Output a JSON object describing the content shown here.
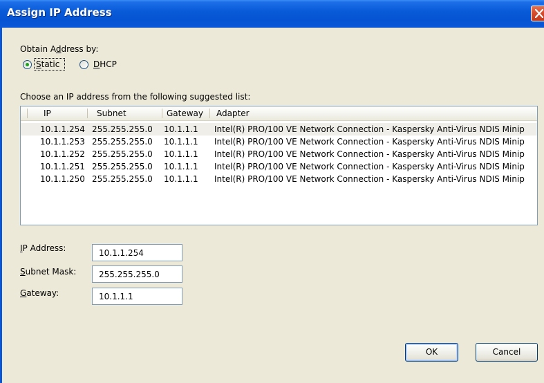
{
  "window": {
    "title": "Assign IP Address"
  },
  "obtain": {
    "label_pre": "Obtain A",
    "label_accel": "d",
    "label_post": "dress by:",
    "options": [
      {
        "accel": "S",
        "rest": "tatic",
        "selected": true
      },
      {
        "accel": "D",
        "rest": "HCP",
        "selected": false
      }
    ]
  },
  "suggested": {
    "label": "Choose an IP address from the following suggested list:",
    "columns": [
      "IP",
      "Subnet",
      "Gateway",
      "Adapter"
    ],
    "rows": [
      {
        "ip": "10.1.1.254",
        "subnet": "255.255.255.0",
        "gateway": "10.1.1.1",
        "adapter": "Intel(R) PRO/100 VE Network Connection - Kaspersky Anti-Virus NDIS Minip",
        "selected": true
      },
      {
        "ip": "10.1.1.253",
        "subnet": "255.255.255.0",
        "gateway": "10.1.1.1",
        "adapter": "Intel(R) PRO/100 VE Network Connection - Kaspersky Anti-Virus NDIS Minip",
        "selected": false
      },
      {
        "ip": "10.1.1.252",
        "subnet": "255.255.255.0",
        "gateway": "10.1.1.1",
        "adapter": "Intel(R) PRO/100 VE Network Connection - Kaspersky Anti-Virus NDIS Minip",
        "selected": false
      },
      {
        "ip": "10.1.1.251",
        "subnet": "255.255.255.0",
        "gateway": "10.1.1.1",
        "adapter": "Intel(R) PRO/100 VE Network Connection - Kaspersky Anti-Virus NDIS Minip",
        "selected": false
      },
      {
        "ip": "10.1.1.250",
        "subnet": "255.255.255.0",
        "gateway": "10.1.1.1",
        "adapter": "Intel(R) PRO/100 VE Network Connection - Kaspersky Anti-Virus NDIS Minip",
        "selected": false
      }
    ]
  },
  "fields": {
    "ip_address": {
      "accel": "I",
      "rest": "P Address:",
      "value": "10.1.1.254"
    },
    "subnet_mask": {
      "accel": "S",
      "rest": "ubnet Mask:",
      "value": "255.255.255.0"
    },
    "gateway": {
      "accel": "G",
      "rest": "ateway:",
      "value": "10.1.1.1"
    }
  },
  "buttons": {
    "ok": "OK",
    "cancel": "Cancel"
  },
  "colors": {
    "titlebar": "#0554d3",
    "dialog_bg": "#ece9d8",
    "radio_dot": "#21a121",
    "close_button": "#d4492a"
  },
  "icons": {
    "close": "close-icon"
  }
}
